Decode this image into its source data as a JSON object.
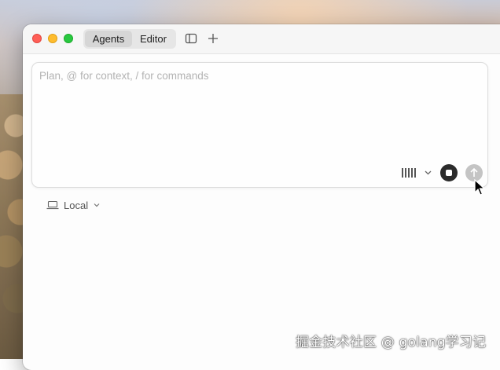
{
  "window": {
    "tabs": [
      {
        "label": "Agents",
        "selected": true
      },
      {
        "label": "Editor",
        "selected": false
      }
    ],
    "toolbar_icons": [
      "sidebar-toggle-icon",
      "plus-icon"
    ]
  },
  "composer": {
    "value": "",
    "placeholder": "Plan, @ for context, / for commands",
    "model_picker_icon": "bars-icon",
    "stop_icon": "stop-icon",
    "send_icon": "arrow-up-icon",
    "send_enabled": false
  },
  "environment": {
    "label": "Local",
    "icon": "laptop-icon"
  },
  "watermark": {
    "text": "掘金技术社区 @ golang学习记"
  },
  "colors": {
    "close": "#ff5f57",
    "minimize": "#febc2e",
    "maximize": "#28c840",
    "stop_button": "#2b2b2b",
    "send_button_disabled": "#c4c4c4"
  }
}
